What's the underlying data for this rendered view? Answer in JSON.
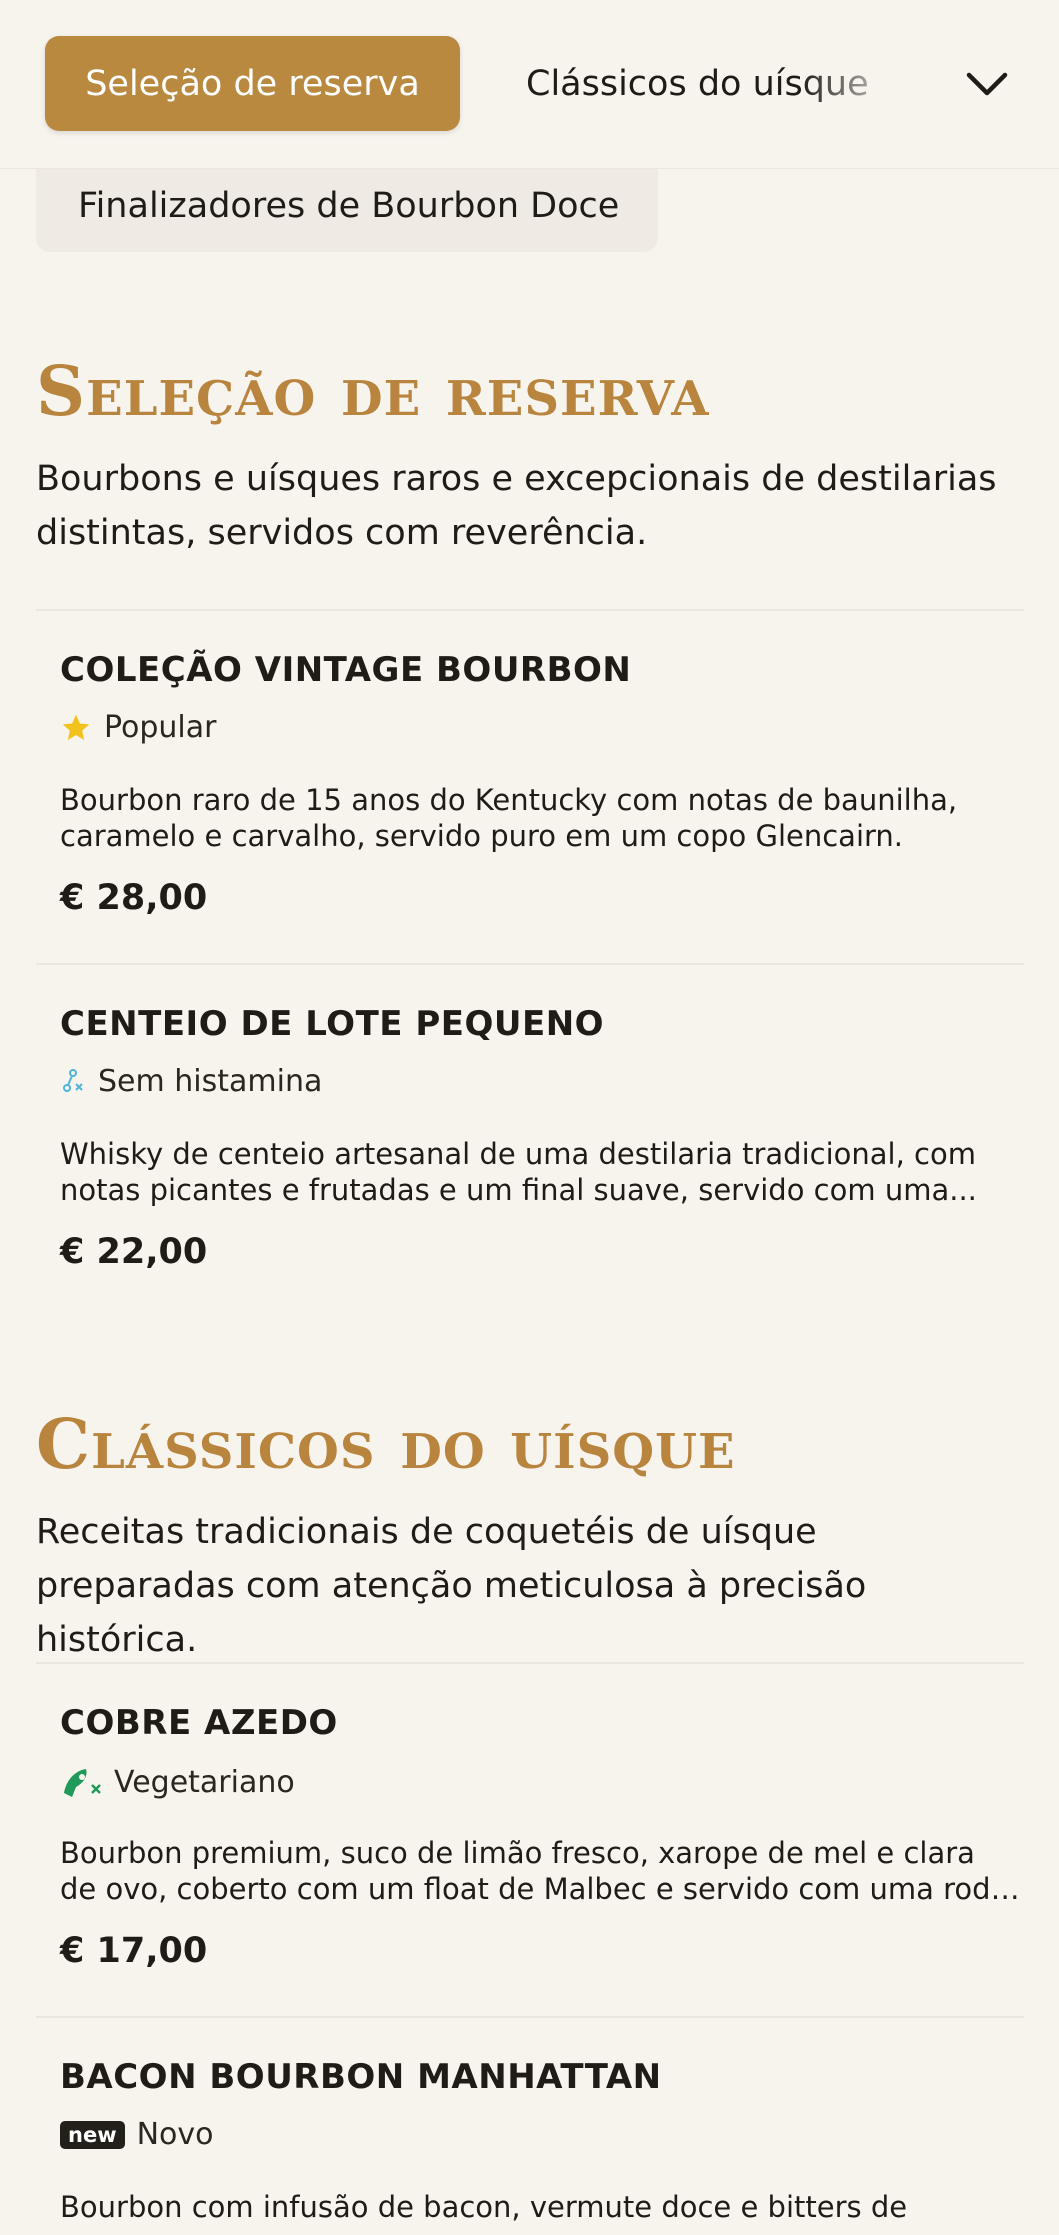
{
  "nav": {
    "active_tab": "Seleção de reserva",
    "next_tab": "Clássicos do uísque",
    "subtab": "Finalizadores de Bourbon Doce",
    "expand_icon": "chevron-down-icon"
  },
  "colors": {
    "accent": "#b8893f",
    "background": "#f7f4ee",
    "text": "#1f1c17"
  },
  "sections": [
    {
      "title": "Seleção de reserva",
      "description": "Bourbons e uísques raros e excepcionais de destilarias distintas, servidos com reverência.",
      "items": [
        {
          "name": "COLEÇÃO VINTAGE BOURBON",
          "tag": "Popular",
          "tag_icon": "star-icon",
          "description": "Bourbon raro de 15 anos do Kentucky com notas de baunilha, caramelo e carvalho, servido puro em um copo Glencairn.",
          "price": "€ 28,00"
        },
        {
          "name": "CENTEIO DE LOTE PEQUENO",
          "tag": "Sem histamina",
          "tag_icon": "histamine-free-icon",
          "description": "Whisky de centeio artesanal de uma destilaria tradicional, com notas picantes e frutadas e um final suave, servido com uma...",
          "price": "€ 22,00"
        }
      ]
    },
    {
      "title": "Clássicos do uísque",
      "description": "Receitas tradicionais de coquetéis de uísque preparadas com atenção meticulosa à precisão histórica.",
      "items": [
        {
          "name": "COBRE AZEDO",
          "tag": "Vegetariano",
          "tag_icon": "vegetarian-icon",
          "description": "Bourbon premium, suco de limão fresco, xarope de mel e clara de ovo, coberto com um float de Malbec e servido com uma roda d...",
          "price": "€ 17,00"
        },
        {
          "name": "BACON BOURBON MANHATTAN",
          "tag": "Novo",
          "tag_icon": "new-badge-icon",
          "badge_text": "new",
          "description": "Bourbon com infusão de bacon, vermute doce e bitters de"
        }
      ]
    }
  ]
}
